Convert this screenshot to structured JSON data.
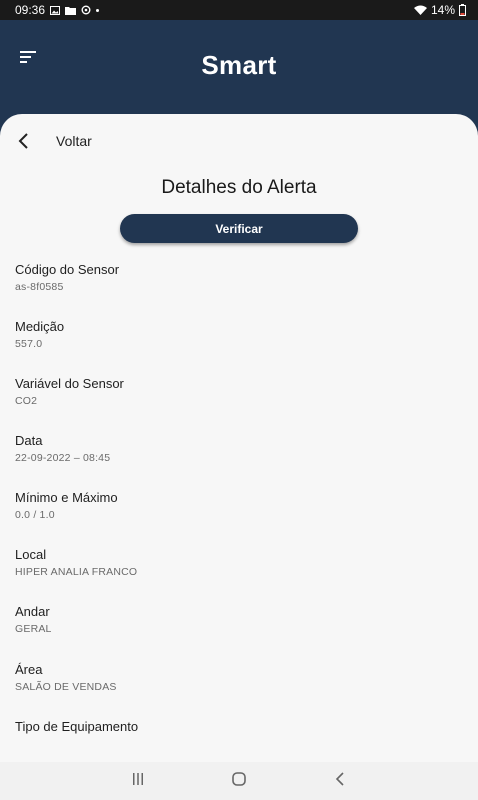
{
  "status_bar": {
    "time": "09:36",
    "battery": "14%",
    "icons": [
      "image-icon",
      "folder-icon",
      "sync-icon",
      "notification-dot",
      "wifi-icon",
      "battery-icon"
    ]
  },
  "app_bar": {
    "title": "Smart",
    "background": "#213651"
  },
  "content": {
    "back_label": "Voltar",
    "page_title": "Detalhes do Alerta",
    "verify_label": "Verificar",
    "fields": [
      {
        "label": "Código do Sensor",
        "value": "as-8f0585"
      },
      {
        "label": "Medição",
        "value": "557.0"
      },
      {
        "label": "Variável do Sensor",
        "value": "CO2"
      },
      {
        "label": "Data",
        "value": "22-09-2022 – 08:45"
      },
      {
        "label": "Mínimo e Máximo",
        "value": "0.0 / 1.0"
      },
      {
        "label": "Local",
        "value": "HIPER ANALIA FRANCO"
      },
      {
        "label": "Andar",
        "value": "GERAL"
      },
      {
        "label": "Área",
        "value": "SALÃO DE VENDAS"
      },
      {
        "label": "Tipo de Equipamento",
        "value": ""
      }
    ]
  },
  "nav_bar": {
    "buttons": [
      "recent-apps",
      "home",
      "back"
    ]
  }
}
